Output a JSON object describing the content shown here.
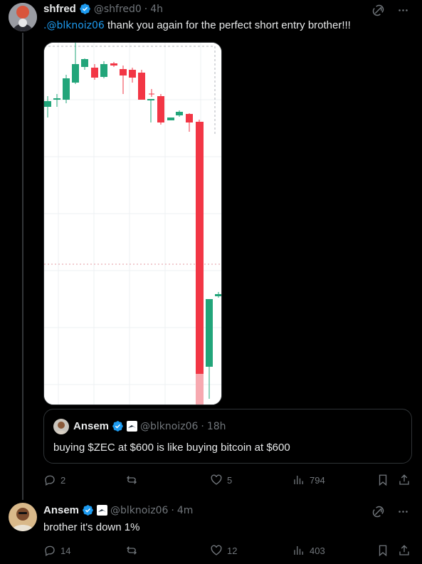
{
  "tweet1": {
    "name": "shfred",
    "handle": "@shfred0",
    "dot": "·",
    "time": "4h",
    "mention": ".@blknoiz06",
    "text": " thank you again for the perfect short entry brother!!!",
    "stats": {
      "replies": "2",
      "reposts": "",
      "likes": "5",
      "views": "794"
    }
  },
  "quote": {
    "name": "Ansem",
    "handle": "@blknoiz06",
    "dot": "·",
    "time": "18h",
    "text": "buying $ZEC at $600 is like buying bitcoin at $600"
  },
  "tweet2": {
    "name": "Ansem",
    "handle": "@blknoiz06",
    "dot": "·",
    "time": "4m",
    "text": "brother it's down 1%",
    "stats": {
      "replies": "14",
      "reposts": "",
      "likes": "12",
      "views": "403"
    }
  },
  "colors": {
    "accent": "#1d9bf0",
    "up": "#22a57a",
    "down": "#f23645",
    "muted": "#71767b"
  },
  "icons": [
    "grok-icon",
    "more-icon",
    "reply-icon",
    "repost-icon",
    "like-icon",
    "views-icon",
    "bookmark-icon",
    "share-icon",
    "verified-icon"
  ]
}
